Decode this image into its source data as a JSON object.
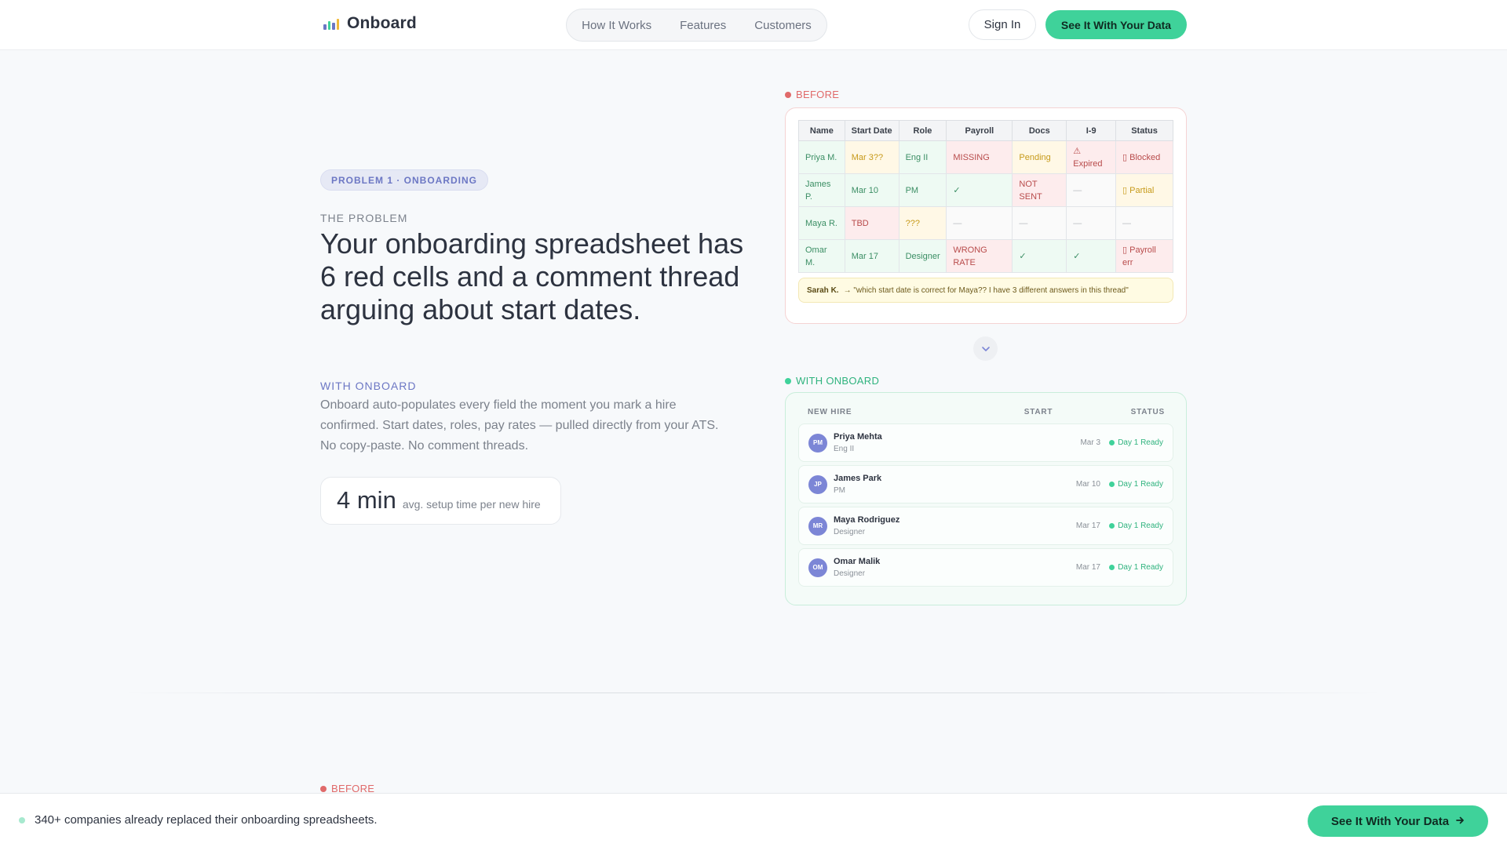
{
  "header": {
    "logo_text": "Onboard",
    "logo_icon": "bar-chart-icon",
    "nav": [
      "How It Works",
      "Features",
      "Customers"
    ],
    "signin_label": "Sign In",
    "cta_label": "See It With Your Data"
  },
  "hero": {
    "badge": "PROBLEM 1 · ONBOARDING",
    "problem_label": "THE PROBLEM",
    "headline": "Your onboarding spreadsheet has 6 red cells and a comment thread arguing about start dates.",
    "onboard_label": "WITH ONBOARD",
    "description": "Onboard auto-populates every field the moment you mark a hire confirmed. Start dates, roles, pay rates — pulled directly from your ATS. No copy-paste. No comment threads.",
    "stat_value": "4 min",
    "stat_label": "avg. setup time per new hire"
  },
  "before": {
    "label": "BEFORE",
    "columns": [
      "Name",
      "Start Date",
      "Role",
      "Payroll",
      "Docs",
      "I-9",
      "Status"
    ],
    "rows": [
      [
        {
          "text": "Priya M.",
          "tone": "green"
        },
        {
          "text": "Mar 3??",
          "tone": "yellow"
        },
        {
          "text": "Eng II",
          "tone": "green"
        },
        {
          "text": "MISSING",
          "tone": "red"
        },
        {
          "text": "Pending",
          "tone": "yellow"
        },
        {
          "text": "⚠ Expired",
          "tone": "red"
        },
        {
          "text": "▯ Blocked",
          "tone": "red"
        }
      ],
      [
        {
          "text": "James P.",
          "tone": "green"
        },
        {
          "text": "Mar 10",
          "tone": "green"
        },
        {
          "text": "PM",
          "tone": "green"
        },
        {
          "text": "✓",
          "tone": "green"
        },
        {
          "text": "NOT SENT",
          "tone": "red"
        },
        {
          "text": "—",
          "tone": "plain"
        },
        {
          "text": "▯ Partial",
          "tone": "yellow"
        }
      ],
      [
        {
          "text": "Maya R.",
          "tone": "green"
        },
        {
          "text": "TBD",
          "tone": "red"
        },
        {
          "text": "???",
          "tone": "yellow"
        },
        {
          "text": "—",
          "tone": "plain"
        },
        {
          "text": "—",
          "tone": "plain"
        },
        {
          "text": "—",
          "tone": "plain"
        },
        {
          "text": "—",
          "tone": "plain"
        }
      ],
      [
        {
          "text": "Omar M.",
          "tone": "green"
        },
        {
          "text": "Mar 17",
          "tone": "green"
        },
        {
          "text": "Designer",
          "tone": "green"
        },
        {
          "text": "WRONG RATE",
          "tone": "red"
        },
        {
          "text": "✓",
          "tone": "green"
        },
        {
          "text": "✓",
          "tone": "green"
        },
        {
          "text": "▯ Payroll err",
          "tone": "red"
        }
      ]
    ],
    "comment_author": "Sarah K.",
    "comment_text": "→ \"which start date is correct for Maya?? I have 3 different answers in this thread\""
  },
  "after": {
    "label": "WITH ONBOARD",
    "columns": [
      "NEW HIRE",
      "START",
      "STATUS"
    ],
    "hires": [
      {
        "initials": "PM",
        "name": "Priya Mehta",
        "role": "Eng II",
        "start": "Mar 3",
        "status": "Day 1 Ready"
      },
      {
        "initials": "JP",
        "name": "James Park",
        "role": "PM",
        "start": "Mar 10",
        "status": "Day 1 Ready"
      },
      {
        "initials": "MR",
        "name": "Maya Rodriguez",
        "role": "Designer",
        "start": "Mar 17",
        "status": "Day 1 Ready"
      },
      {
        "initials": "OM",
        "name": "Omar Malik",
        "role": "Designer",
        "start": "Mar 17",
        "status": "Day 1 Ready"
      }
    ]
  },
  "lower": {
    "before_label": "BEFORE"
  },
  "bottom_bar": {
    "text": "340+ companies already replaced their onboarding spreadsheets.",
    "cta_label": "See It With Your Data"
  },
  "colors": {
    "accent": "#3fd29a",
    "indigo": "#6c77c4",
    "red": "#e06a6a"
  }
}
